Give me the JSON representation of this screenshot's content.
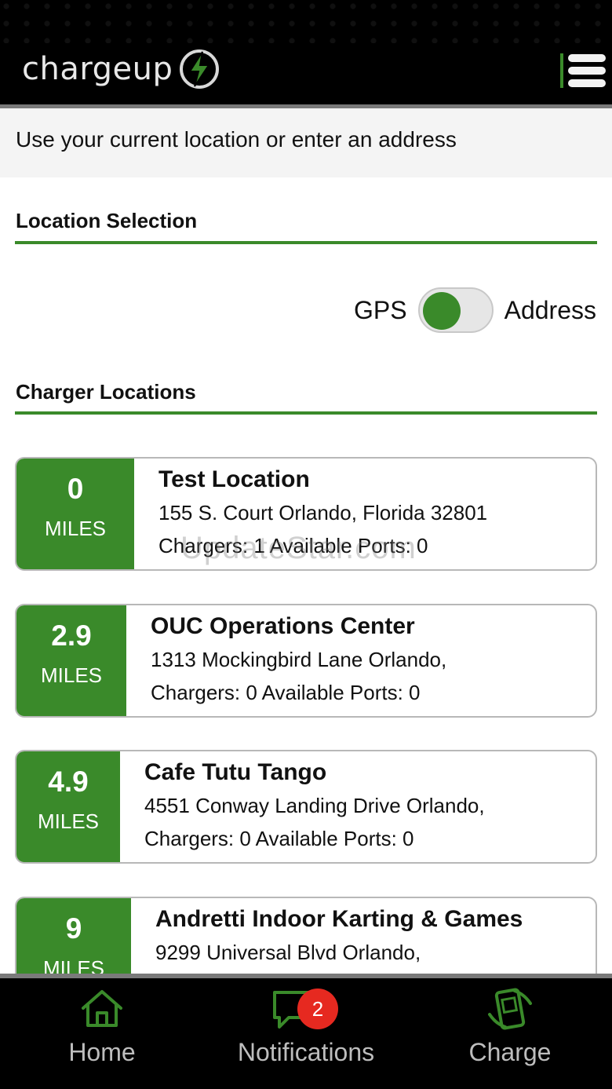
{
  "header": {
    "logo_text": "chargeup",
    "menu_icon": "hamburger-menu-icon",
    "accent_color": "#3a8a2a"
  },
  "instruction": "Use your current location or enter an address",
  "location_section": {
    "title": "Location Selection",
    "toggle_left_label": "GPS",
    "toggle_right_label": "Address",
    "toggle_state": "GPS"
  },
  "chargers_section": {
    "title": "Charger Locations",
    "unit": "MILES",
    "items": [
      {
        "distance": "0",
        "name": "Test Location",
        "address": "155 S. Court Orlando, Florida 32801",
        "stats": "Chargers: 1  Available Ports: 0"
      },
      {
        "distance": "2.9",
        "name": "OUC Operations Center",
        "address": "1313 Mockingbird Lane Orlando,",
        "stats": "Chargers: 0  Available Ports: 0"
      },
      {
        "distance": "4.9",
        "name": "Cafe Tutu Tango",
        "address": "4551 Conway Landing Drive Orlando,",
        "stats": "Chargers: 0  Available Ports: 0"
      },
      {
        "distance": "9",
        "name": "Andretti Indoor Karting & Games",
        "address": "9299 Universal Blvd Orlando,",
        "stats": ""
      }
    ]
  },
  "watermark": "UpdateStar.com",
  "bottom_nav": {
    "home_label": "Home",
    "notifications_label": "Notifications",
    "notifications_badge": "2",
    "charge_label": "Charge"
  }
}
